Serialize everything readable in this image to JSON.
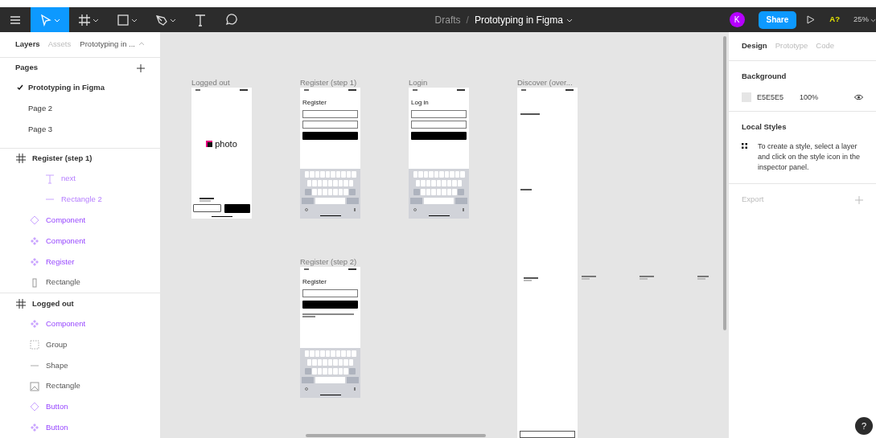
{
  "toolbar": {
    "tools": [
      {
        "kind": "menu",
        "selected": false
      },
      {
        "kind": "move",
        "selected": true
      },
      {
        "kind": "frame",
        "selected": false
      },
      {
        "kind": "shape",
        "selected": false
      },
      {
        "kind": "pen",
        "selected": false
      },
      {
        "kind": "text",
        "selected": false
      },
      {
        "kind": "comment",
        "selected": false
      }
    ],
    "breadcrumb": {
      "folder": "Drafts",
      "separator": "/",
      "file": "Prototyping in Figma"
    },
    "avatar": "K",
    "share": "Share",
    "badge": "A?",
    "zoom": "25%"
  },
  "left_panel": {
    "tabs": [
      {
        "label": "Layers",
        "selected": true
      },
      {
        "label": "Assets",
        "selected": false
      }
    ],
    "page_menu": "Prototyping in ...",
    "pages_title": "Pages",
    "pages": [
      {
        "label": "Prototyping in Figma",
        "selected": true
      },
      {
        "label": "Page 2",
        "selected": false
      },
      {
        "label": "Page 3",
        "selected": false
      }
    ],
    "layers": [
      {
        "label": "Register (step 1)",
        "kind": "frame",
        "children": [
          {
            "children": [
              {
                "label": "next",
                "kind": "text"
              },
              {
                "label": "Rectangle 2",
                "kind": "line"
              }
            ]
          },
          {
            "label": "Component",
            "kind": "component"
          },
          {
            "label": "Component",
            "kind": "instance"
          },
          {
            "label": "Register",
            "kind": "instance"
          },
          {
            "label": "Rectangle",
            "kind": "rectangle"
          }
        ]
      },
      {
        "label": "Logged out",
        "kind": "frame",
        "children": [
          {
            "label": "Component",
            "kind": "instance"
          },
          {
            "label": "Group",
            "kind": "group"
          },
          {
            "label": "Shape",
            "kind": "shape"
          },
          {
            "label": "Rectangle",
            "kind": "image"
          },
          {
            "label": "Button",
            "kind": "component"
          },
          {
            "label": "Button",
            "kind": "instance"
          }
        ]
      }
    ]
  },
  "canvas": {
    "frames": [
      {
        "title": "Logged out",
        "kind": "splash",
        "logo": "photo"
      },
      {
        "title": "Register (step 1)",
        "kind": "email_form",
        "heading": "Register"
      },
      {
        "title": "Login",
        "kind": "email_form",
        "heading": "Log in"
      },
      {
        "title": "Discover (over...",
        "kind": "feed"
      },
      {
        "title": "Register (step 2)",
        "kind": "name_form",
        "heading": "Register"
      }
    ]
  },
  "right_panel": {
    "tabs": [
      {
        "label": "Design",
        "selected": true
      },
      {
        "label": "Prototype",
        "selected": false
      },
      {
        "label": "Code",
        "selected": false
      }
    ],
    "background": {
      "title": "Background",
      "color": "#e5e5e5",
      "hex": "E5E5E5",
      "opacity": "100%"
    },
    "local_styles": {
      "title": "Local Styles",
      "hint": "To create a style, select a layer and click on the style icon in the inspector panel."
    },
    "export": {
      "title": "Export"
    }
  },
  "help": "?"
}
